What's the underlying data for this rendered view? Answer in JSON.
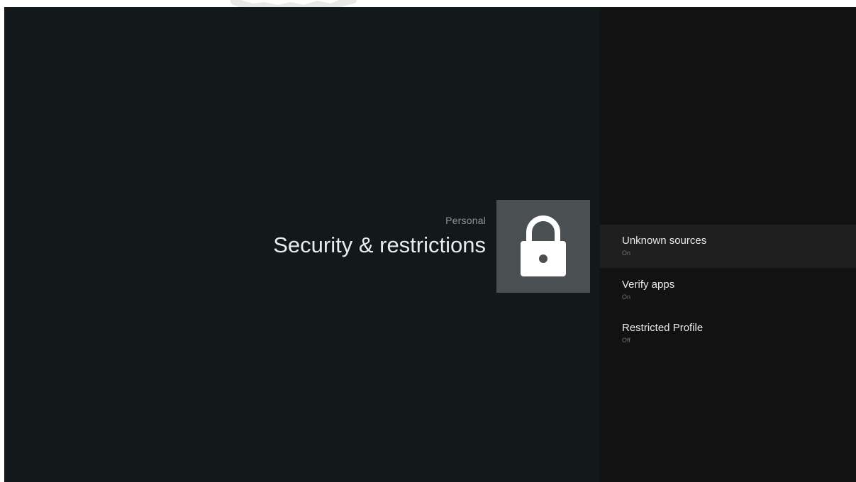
{
  "header": {
    "category": "Personal",
    "title": "Security & restrictions",
    "icon": "lock-icon"
  },
  "menu": {
    "items": [
      {
        "label": "Unknown sources",
        "status": "On",
        "selected": true
      },
      {
        "label": "Verify apps",
        "status": "On",
        "selected": false
      },
      {
        "label": "Restricted Profile",
        "status": "Off",
        "selected": false
      }
    ]
  },
  "colors": {
    "background_left": "#13181b",
    "background_right": "#121212",
    "icon_tile": "#4a4f52",
    "selected_row": "#1f1f1f"
  }
}
